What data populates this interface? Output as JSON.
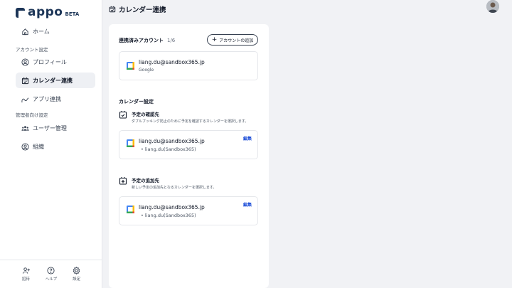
{
  "brand": {
    "name": "appo",
    "badge": "BETA"
  },
  "sidebar": {
    "home": "ホーム",
    "section_account": "アカウント設定",
    "profile": "プロフィール",
    "calendar": "カレンダー連携",
    "apps": "アプリ連携",
    "section_admin": "管理者向け設定",
    "users": "ユーザー管理",
    "org": "組織"
  },
  "bottom": {
    "invite": "招待",
    "help": "ヘルプ",
    "settings": "設定"
  },
  "page": {
    "title": "カレンダー連携"
  },
  "accounts": {
    "heading": "連携済みアカウント",
    "count": "1/6",
    "add_label": "アカウントの追加",
    "items": [
      {
        "email": "liang.du@sandbox365.jp",
        "provider": "Google"
      }
    ]
  },
  "calendar_settings": {
    "heading": "カレンダー設定",
    "check": {
      "title": "予定の確認先",
      "desc": "ダブルブッキング防止のために予定を確認するカレンダーを選択します。",
      "email": "liang.du@sandbox365.jp",
      "calendar": "liang.du(Sandbox365)",
      "edit": "編集"
    },
    "add": {
      "title": "予定の追加先",
      "desc": "新しい予定の追加先となるカレンダーを選択します。",
      "email": "liang.du@sandbox365.jp",
      "calendar": "liang.du(Sandbox365)",
      "edit": "編集"
    }
  },
  "colors": {
    "brand": "#1c3557",
    "link": "#1d4ed8",
    "active_bg": "#eef0f4"
  }
}
